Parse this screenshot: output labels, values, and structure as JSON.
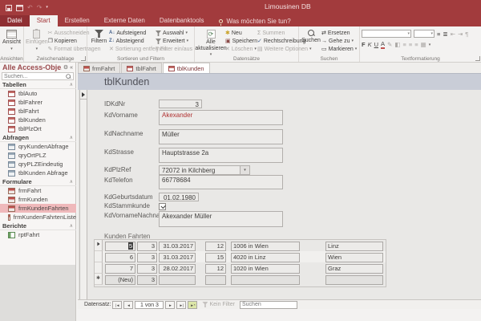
{
  "titlebar": {
    "title": "Limousinen DB"
  },
  "icons": {
    "caret": "▾",
    "undo": "↶",
    "redo": "↷",
    "gear": "⚙",
    "collapse": "«",
    "pin": "∧",
    "cut": "✂",
    "copy_hint": "❐",
    "sigma": "Σ",
    "check": "✓",
    "star": "✱",
    "cross": "✕",
    "asc": "A↓",
    "desc": "Z↓",
    "arrow": "→",
    "swap": "⇄",
    "select_box": "▭",
    "first": "|◄",
    "prev": "◄",
    "next": "►",
    "last": "►|",
    "new_rec": "►*",
    "new_row_star": "✱",
    "bullets": "≡",
    "numbering": "≣",
    "more": "▤"
  },
  "ribbon": {
    "tabs": [
      {
        "label": "Datei"
      },
      {
        "label": "Start"
      },
      {
        "label": "Erstellen"
      },
      {
        "label": "Externe Daten"
      },
      {
        "label": "Datenbanktools"
      }
    ],
    "tell_me": "Was möchten Sie tun?",
    "ansichten": {
      "label": "Ansichten",
      "ansicht": "Ansicht"
    },
    "zwischenablage": {
      "label": "Zwischenablage",
      "einfuegen": "Einfügen",
      "ausschneiden": "Ausschneiden",
      "kopieren": "Kopieren",
      "format": "Format übertragen"
    },
    "sortieren": {
      "label": "Sortieren und Filtern",
      "filtern": "Filtern",
      "auf": "Aufsteigend",
      "ab": "Absteigend",
      "entf": "Sortierung entfernen",
      "auswahl": "Auswahl",
      "erweitert": "Erweitert",
      "einaus": "Filter ein/aus"
    },
    "datensaetze": {
      "label": "Datensätze",
      "aktualisieren": "Alle aktualisieren",
      "neu": "Neu",
      "speichern": "Speichern",
      "loeschen": "Löschen",
      "summen": "Summen",
      "recht": "Rechtschreibung",
      "weitere": "Weitere Optionen"
    },
    "suchen": {
      "label": "Suchen",
      "suchen": "Suchen",
      "ersetzen": "Ersetzen",
      "gehezu": "Gehe zu",
      "markieren": "Markieren"
    },
    "textformat": {
      "label": "Textformatierung",
      "f": "F",
      "k": "K",
      "u": "U",
      "a": "A"
    }
  },
  "sidebar": {
    "title": "Alle Access-Obje...",
    "search_placeholder": "Suchen...",
    "sections": [
      {
        "label": "Tabellen",
        "items": [
          {
            "label": "tblAuto"
          },
          {
            "label": "tblFahrer"
          },
          {
            "label": "tblFahrt"
          },
          {
            "label": "tblKunden"
          },
          {
            "label": "tblPlzOrt"
          }
        ]
      },
      {
        "label": "Abfragen",
        "items": [
          {
            "label": "qryKundenAbfrage"
          },
          {
            "label": "qryOrtPLZ"
          },
          {
            "label": "qryPLZEindeutig"
          },
          {
            "label": "tblKunden Abfrage"
          }
        ]
      },
      {
        "label": "Formulare",
        "items": [
          {
            "label": "frmFahrt"
          },
          {
            "label": "frmKunden"
          },
          {
            "label": "frmKundenFahrten"
          },
          {
            "label": "frmKundenFahrtenListe"
          }
        ]
      },
      {
        "label": "Berichte",
        "items": [
          {
            "label": "rptFahrt"
          }
        ]
      }
    ],
    "selected_item": "frmKundenFahrten"
  },
  "doc_tabs": [
    {
      "label": "frmFahrt"
    },
    {
      "label": "tblFahrt"
    },
    {
      "label": "tblKunden"
    }
  ],
  "form": {
    "title": "tblKunden",
    "fields": {
      "idkdnr": {
        "label": "IDKdNr",
        "value": "3"
      },
      "vorname": {
        "label": "KdVorname",
        "value": "Akexander"
      },
      "nachname": {
        "label": "KdNachname",
        "value": "Müller"
      },
      "strasse": {
        "label": "KdStrasse",
        "value": "Hauptstrasse 2a"
      },
      "plzref": {
        "label": "KdPlzRef",
        "value": "72072 in Kilchberg"
      },
      "telefon": {
        "label": "KdTelefon",
        "value": "66778684"
      },
      "geburtsdatum": {
        "label": "KdGeburtsdatum",
        "value": "01.02.1980"
      },
      "stammkunde": {
        "label": "KdStammkunde",
        "checked": true
      },
      "vornamenachname": {
        "label": "KdVornameNachname",
        "value": "Akexander Müller"
      }
    },
    "subform": {
      "label": "Kunden Fahrten",
      "rows": [
        {
          "cells": [
            "5",
            "3",
            "31.03.2017",
            "12",
            "1006 in Wien",
            "Linz"
          ]
        },
        {
          "cells": [
            "6",
            "3",
            "31.03.2017",
            "15",
            "4020 in Linz",
            "Wien"
          ]
        },
        {
          "cells": [
            "7",
            "3",
            "28.02.2017",
            "12",
            "1020 in Wien",
            "Graz"
          ]
        },
        {
          "cells": [
            "(Neu)",
            "3",
            "",
            "",
            "",
            ""
          ]
        }
      ]
    },
    "navigator": {
      "label": "Datensatz:",
      "position": "1 von 3",
      "filter_label": "Kein Filter",
      "search_placeholder": "Suchen"
    }
  },
  "colors": {
    "accent_red": "#A23B3D",
    "value_red": "#B03030",
    "selection_pink": "#EFB9BB",
    "form_header_blue": "#C9CDD7"
  }
}
